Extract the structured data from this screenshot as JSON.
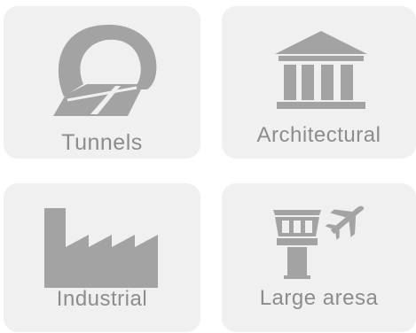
{
  "tiles": [
    {
      "label": "Tunnels",
      "icon": "tunnel-icon"
    },
    {
      "label": "Architectural",
      "icon": "columns-building-icon"
    },
    {
      "label": "Industrial",
      "icon": "factory-icon"
    },
    {
      "label": "Large aresa",
      "icon": "control-tower-airplane-icon"
    }
  ],
  "colors": {
    "tile_background": "#f0f0f0",
    "icon_gray": "#a3a3a3",
    "label_gray": "#8c8c8c"
  }
}
